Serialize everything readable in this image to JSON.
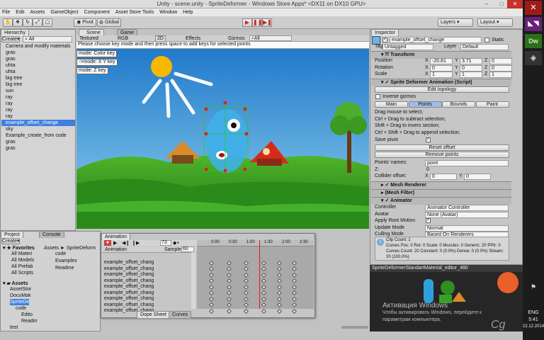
{
  "window": {
    "title": "Unity - scene.unity - SpriteDeformer - Windows Store Apps* <DX11 on DX10 GPU>"
  },
  "menu": [
    "File",
    "Edit",
    "Assets",
    "GameObject",
    "Component",
    "Asset Store Tools",
    "Window",
    "Help"
  ],
  "toolbar": {
    "pivot": "Pivot",
    "global": "Global",
    "layers": "Layers",
    "layout": "Layout"
  },
  "hierarchy": {
    "tab": "Hierarchy",
    "create": "Create",
    "search": "All",
    "items": [
      "Camera and modify materials",
      "gras",
      "gras",
      "uhta",
      "uhta",
      "big tree",
      "big tree",
      "sun",
      "ray",
      "ray",
      "ray",
      "ray",
      "example_offset_change",
      "sky",
      "Example_create_from code",
      "gras",
      "gras"
    ],
    "selected_index": 12
  },
  "scene": {
    "tab_scene": "Scene",
    "tab_game": "Game",
    "shading": "Textured",
    "rgb": "RGB",
    "mode2d": "2D",
    "effects": "Effects",
    "gizmos": "Gizmos",
    "search": "All",
    "hint": "Please choose key mode and then press space to add keys for selected points",
    "modes": [
      "mode: Color key",
      "->mode: X Y key",
      "mode: Z key"
    ]
  },
  "project": {
    "tab_project": "Project",
    "tab_console": "Console",
    "create": "Create",
    "favorites_label": "Favorites",
    "favorites": [
      "All Materi",
      "All Models",
      "All Prefab",
      "All Scripts"
    ],
    "assets_label": "Assets",
    "assets_tree": [
      "AssetStor",
      "DocuMak",
      "SpriteDe",
      "code",
      "Edito",
      "Readm",
      "test"
    ],
    "breadcrumb": "Assets ► SpriteDeform",
    "files": [
      "code",
      "Examples",
      "Readme"
    ]
  },
  "animation": {
    "tab": "Animation",
    "frame": "73",
    "sample_label": "Sample",
    "sample_value": "60",
    "header": "Animation",
    "rows": [
      "example_offset_chang",
      "example_offset_chang",
      "example_offset_chang",
      "example_offset_chang",
      "example_offset_chang",
      "example_offset_chang",
      "example_offset_chang",
      "example_offset_chang",
      "example_offset_chang"
    ],
    "time_labels": [
      "0:00",
      "0:30",
      "1:00",
      "1:30",
      "2:00",
      "2:30"
    ],
    "dope_sheet": "Dope Sheet",
    "curves": "Curves"
  },
  "inspector": {
    "tab": "Inspector",
    "object_name": "example_offset_change",
    "static_label": "Static",
    "tag_label": "Tag",
    "tag_value": "Untagged",
    "layer_label": "Layer",
    "layer_value": "Default",
    "transform": {
      "title": "Transform",
      "position": {
        "label": "Position",
        "x": "-20.81",
        "y": "3.71",
        "z": "0"
      },
      "rotation": {
        "label": "Rotation",
        "x": "0",
        "y": "0",
        "z": "0"
      },
      "scale": {
        "label": "Scale",
        "x": "1",
        "y": "1",
        "z": "1"
      }
    },
    "sprite_deformer": {
      "title": "Sprite Deformer Animation (Script)",
      "edit_topology": "Edit topology",
      "inverse_gizmos": "Inverse gizmos",
      "tabs": [
        "Main",
        "Points",
        "Bounds",
        "Paint"
      ],
      "help": [
        "Drag mouse to select;",
        "Ctrl + Drag to subtract selection;",
        "Shift + Drag to invers section;",
        "Ctrl + Shift + Drag to append selection;"
      ],
      "save_pivot": "Save pivot",
      "reset_offset": "Reset offset",
      "remove_points": "Remove points",
      "points_names_label": "Points' names:",
      "points_names_value": "point",
      "z_label": "Z:",
      "z_value": "0",
      "collider_offset_label": "Collider offset:",
      "collider_x": "0",
      "collider_y": "0"
    },
    "mesh_renderer": "Mesh Renderer",
    "mesh_filter": "(Mesh Filter)",
    "animator": {
      "title": "Animator",
      "controller_label": "Controller",
      "controller_value": "Animator Controller",
      "avatar_label": "Avatar",
      "avatar_value": "None (Avatar)",
      "root_motion_label": "Apply Root Motion",
      "update_label": "Update Mode",
      "update_value": "Normal",
      "culling_label": "Culling Mode",
      "culling_value": "Based On Renderers",
      "info": [
        "Clip Count: 1",
        "Curves Pos: 0 Rot: 0 Scale: 0 Muscles: 0 Generic: 20 PPtr: 0",
        "Curves Count: 20 Constant: 0 (0.0%) Dense: 0 (0.0%) Stream:",
        "20 (100.0%)"
      ]
    }
  },
  "preview": {
    "title": "SpriteDeformerStandartMaterial_editor_480"
  },
  "activation": {
    "line1": "Активация Windows",
    "line2": "Чтобы активировать Windows, перейдите к",
    "line3": "параметрам компьютера."
  },
  "taskbar": {
    "lang": "ENG",
    "time": "5:41",
    "date": "22.12.2014"
  },
  "watermark": "Cg"
}
